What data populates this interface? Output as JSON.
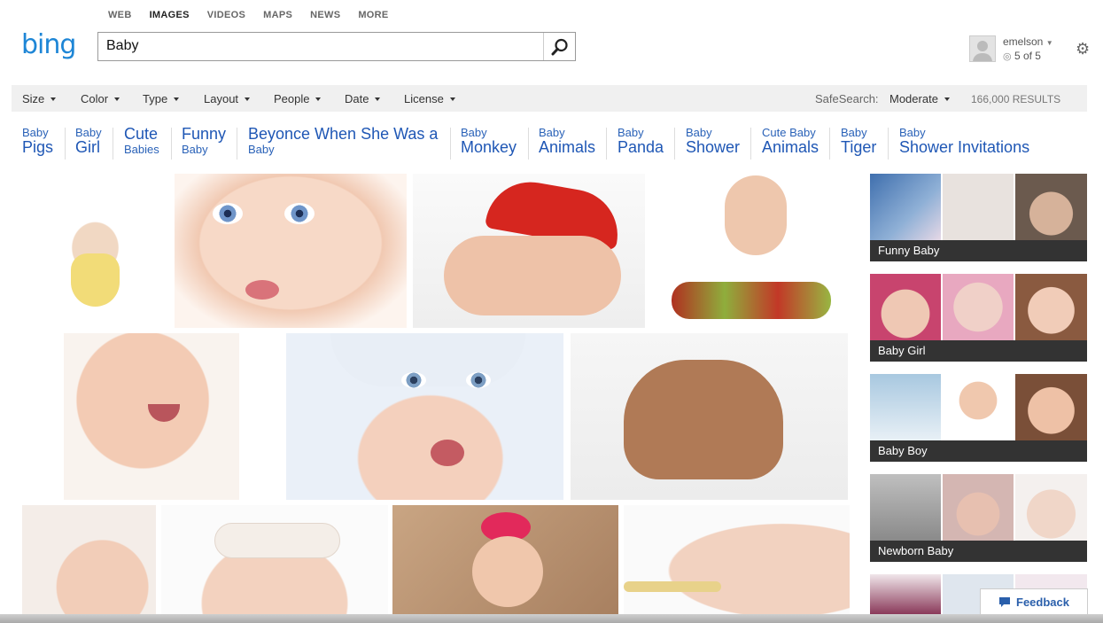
{
  "nav": {
    "tabs": [
      "WEB",
      "IMAGES",
      "VIDEOS",
      "MAPS",
      "NEWS",
      "MORE"
    ],
    "active": "IMAGES"
  },
  "logo": {
    "text": "bing"
  },
  "search": {
    "value": "Baby",
    "icon": "search-icon"
  },
  "user": {
    "name": "emelson",
    "rewards": "5 of 5"
  },
  "filters": [
    "Size",
    "Color",
    "Type",
    "Layout",
    "People",
    "Date",
    "License"
  ],
  "safesearch": {
    "label": "SafeSearch:",
    "value": "Moderate"
  },
  "results_count": "166,000 RESULTS",
  "related": [
    {
      "small": "Baby",
      "big": "Pigs",
      "order": "small-first"
    },
    {
      "small": "Baby",
      "big": "Girl",
      "order": "small-first"
    },
    {
      "small": "Babies",
      "big": "Cute",
      "order": "big-first"
    },
    {
      "small": "Baby",
      "big": "Funny",
      "order": "big-first"
    },
    {
      "small": "Baby",
      "big": "Beyonce When She Was a",
      "order": "big-first"
    },
    {
      "small": "Baby",
      "big": "Monkey",
      "order": "small-first"
    },
    {
      "small": "Baby",
      "big": "Animals",
      "order": "small-first"
    },
    {
      "small": "Baby",
      "big": "Panda",
      "order": "small-first"
    },
    {
      "small": "Baby",
      "big": "Shower",
      "order": "small-first"
    },
    {
      "small": "Cute Baby",
      "big": "Animals",
      "order": "small-first"
    },
    {
      "small": "Baby",
      "big": "Tiger",
      "order": "small-first"
    },
    {
      "small": "Baby",
      "big": "Shower Invitations",
      "order": "small-first"
    }
  ],
  "side_groups": [
    {
      "caption": "Funny Baby"
    },
    {
      "caption": "Baby Girl"
    },
    {
      "caption": "Baby Boy"
    },
    {
      "caption": "Newborn Baby"
    }
  ],
  "feedback": {
    "label": "Feedback"
  },
  "colors": {
    "brand": "#1e86d6",
    "link": "#1f57b5",
    "caption_bg": "#333333"
  }
}
